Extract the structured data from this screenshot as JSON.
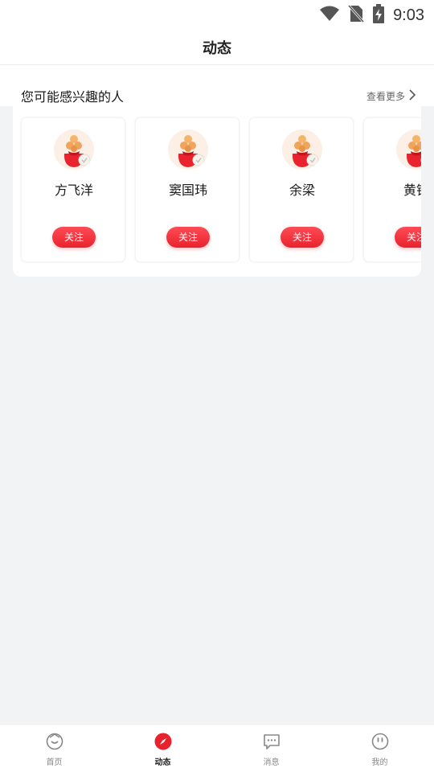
{
  "status_bar": {
    "time": "9:03",
    "icons": [
      "wifi-icon",
      "no-sim-icon",
      "battery-charging-icon"
    ]
  },
  "header": {
    "title": "动态"
  },
  "recommend": {
    "title": "您可能感兴趣的人",
    "more_label": "查看更多",
    "users": [
      {
        "name": "方飞洋",
        "follow_label": "关注"
      },
      {
        "name": "窦国玮",
        "follow_label": "关注"
      },
      {
        "name": "余梁",
        "follow_label": "关注"
      },
      {
        "name": "黄铮",
        "follow_label": "关注"
      }
    ]
  },
  "tab_bar": {
    "items": [
      {
        "label": "首页",
        "icon": "home-icon",
        "active": false
      },
      {
        "label": "动态",
        "icon": "compass-icon",
        "active": true
      },
      {
        "label": "消息",
        "icon": "message-icon",
        "active": false
      },
      {
        "label": "我的",
        "icon": "profile-icon",
        "active": false
      }
    ]
  },
  "colors": {
    "accent": "#e8232e",
    "page_background": "#f2f3f5",
    "tab_inactive": "#888888"
  }
}
